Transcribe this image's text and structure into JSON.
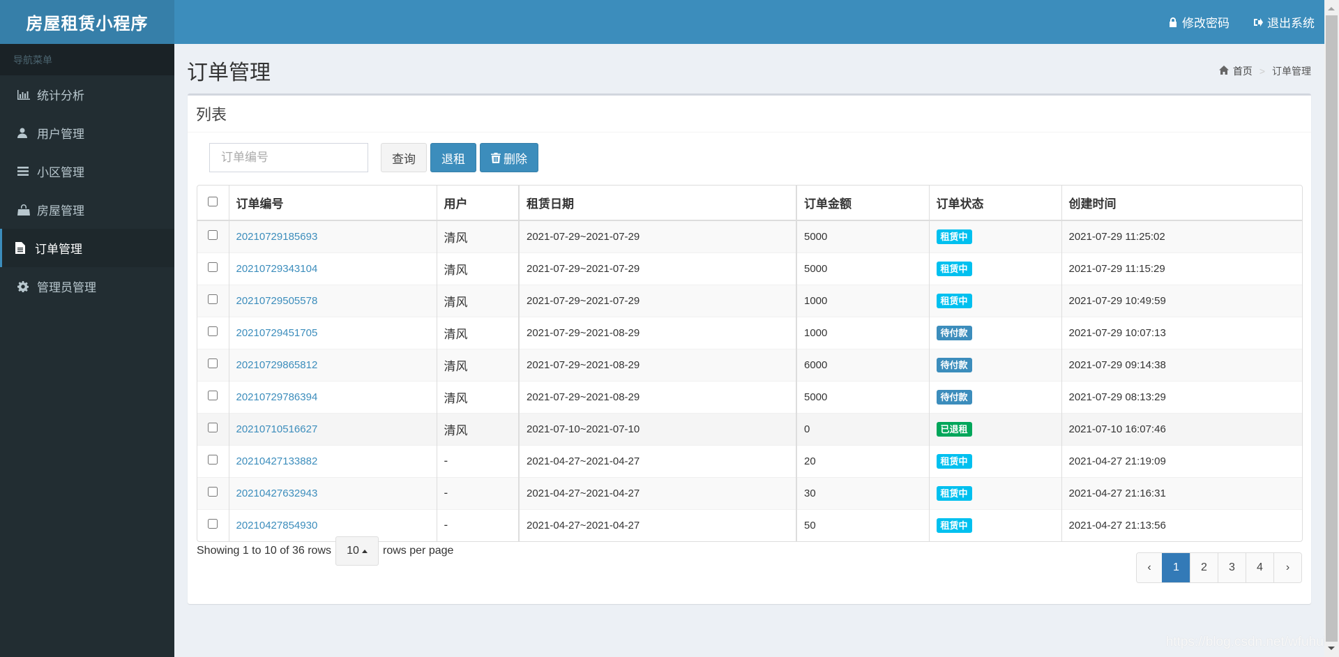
{
  "app": {
    "title": "房屋租赁小程序"
  },
  "header": {
    "change_password": "修改密码",
    "logout": "退出系统"
  },
  "sidebar": {
    "header": "导航菜单",
    "items": [
      {
        "label": "统计分析",
        "icon": "bar-chart-icon",
        "active": false
      },
      {
        "label": "用户管理",
        "icon": "user-icon",
        "active": false
      },
      {
        "label": "小区管理",
        "icon": "list-icon",
        "active": false
      },
      {
        "label": "房屋管理",
        "icon": "shopping-bag-icon",
        "active": false
      },
      {
        "label": "订单管理",
        "icon": "file-icon",
        "active": true
      },
      {
        "label": "管理员管理",
        "icon": "gear-icon",
        "active": false
      }
    ]
  },
  "page": {
    "title": "订单管理",
    "breadcrumb": {
      "home": "首页",
      "current": "订单管理"
    }
  },
  "box": {
    "title": "列表"
  },
  "toolbar": {
    "search_placeholder": "订单编号",
    "search_value": "",
    "query_label": "查询",
    "return_label": "退租",
    "delete_label": "删除"
  },
  "table": {
    "columns": [
      "订单编号",
      "用户",
      "租赁日期",
      "订单金额",
      "订单状态",
      "创建时间"
    ],
    "rows": [
      {
        "order_no": "20210729185693",
        "user": "清风",
        "period": "2021-07-29~2021-07-29",
        "amount": "5000",
        "status": "租赁中",
        "created": "2021-07-29 11:25:02"
      },
      {
        "order_no": "20210729343104",
        "user": "清风",
        "period": "2021-07-29~2021-07-29",
        "amount": "5000",
        "status": "租赁中",
        "created": "2021-07-29 11:15:29"
      },
      {
        "order_no": "20210729505578",
        "user": "清风",
        "period": "2021-07-29~2021-07-29",
        "amount": "1000",
        "status": "租赁中",
        "created": "2021-07-29 10:49:59"
      },
      {
        "order_no": "20210729451705",
        "user": "清风",
        "period": "2021-07-29~2021-08-29",
        "amount": "1000",
        "status": "待付款",
        "created": "2021-07-29 10:07:13"
      },
      {
        "order_no": "20210729865812",
        "user": "清风",
        "period": "2021-07-29~2021-08-29",
        "amount": "6000",
        "status": "待付款",
        "created": "2021-07-29 09:14:38"
      },
      {
        "order_no": "20210729786394",
        "user": "清风",
        "period": "2021-07-29~2021-08-29",
        "amount": "5000",
        "status": "待付款",
        "created": "2021-07-29 08:13:29"
      },
      {
        "order_no": "20210710516627",
        "user": "清风",
        "period": "2021-07-10~2021-07-10",
        "amount": "0",
        "status": "已退租",
        "created": "2021-07-10 16:07:46"
      },
      {
        "order_no": "20210427133882",
        "user": "-",
        "period": "2021-04-27~2021-04-27",
        "amount": "20",
        "status": "租赁中",
        "created": "2021-04-27 21:19:09"
      },
      {
        "order_no": "20210427632943",
        "user": "-",
        "period": "2021-04-27~2021-04-27",
        "amount": "30",
        "status": "租赁中",
        "created": "2021-04-27 21:16:31"
      },
      {
        "order_no": "20210427854930",
        "user": "-",
        "period": "2021-04-27~2021-04-27",
        "amount": "50",
        "status": "租赁中",
        "created": "2021-04-27 21:13:56"
      }
    ],
    "status_colors": {
      "租赁中": "#00c0ef",
      "待付款": "#3c8dbc",
      "已退租": "#00a65a"
    }
  },
  "footer": {
    "showing": "Showing 1 to 10 of 36 rows",
    "page_size": "10",
    "rows_per_page": "rows per page",
    "pages": [
      "‹",
      "1",
      "2",
      "3",
      "4",
      "›"
    ],
    "current_page": "1"
  },
  "watermark": "https://blog.csdn.net/wfuhui"
}
